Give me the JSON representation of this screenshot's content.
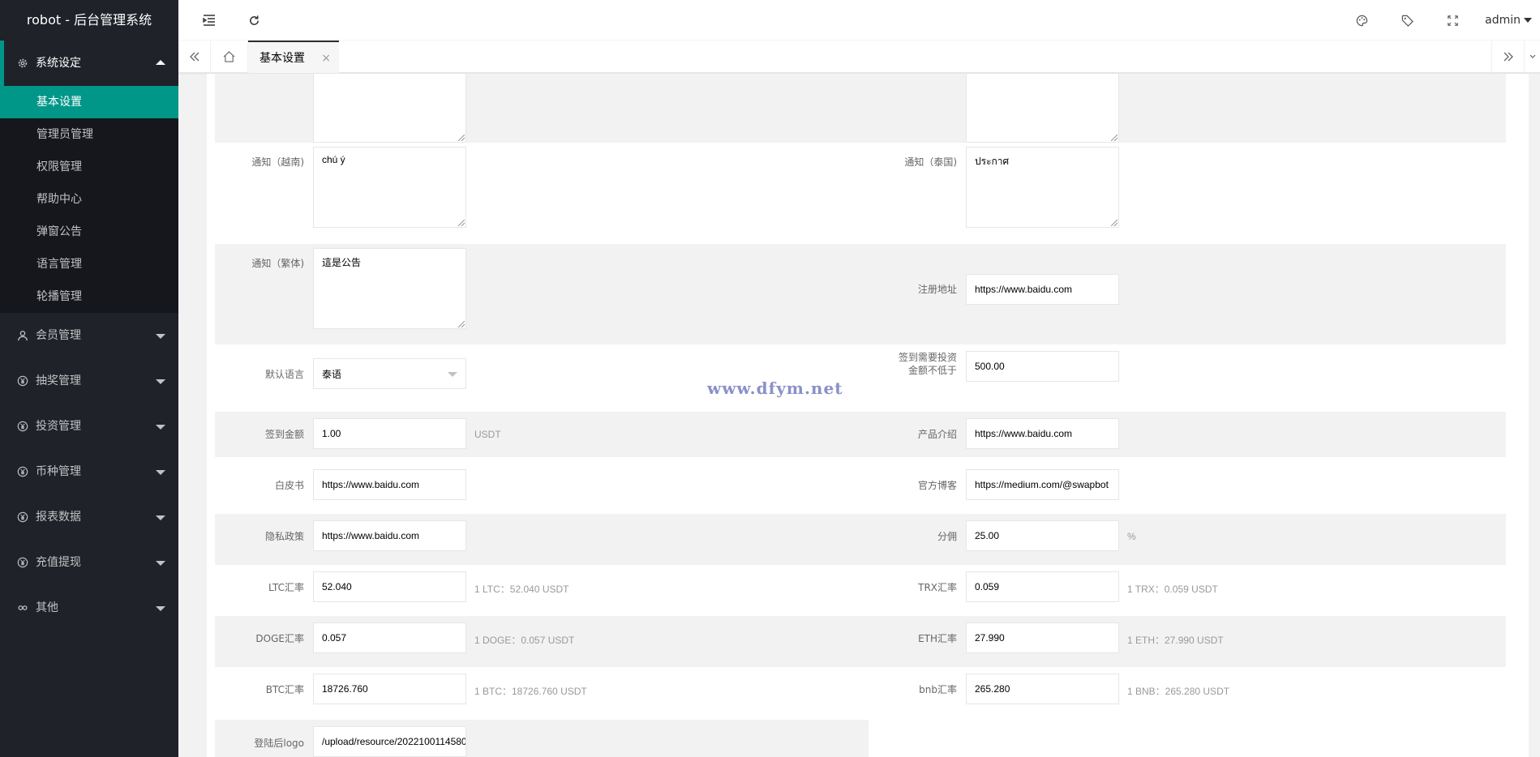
{
  "app_title": "robot - 后台管理系统",
  "header": {
    "user": "admin"
  },
  "sidebar": {
    "groups": [
      {
        "label": "系统设定",
        "icon": "gear-icon",
        "open": true,
        "items": [
          "基本设置",
          "管理员管理",
          "权限管理",
          "帮助中心",
          "弹窗公告",
          "语言管理",
          "轮播管理"
        ],
        "active_item": "基本设置"
      },
      {
        "label": "会员管理",
        "icon": "user-icon",
        "open": false
      },
      {
        "label": "抽奖管理",
        "icon": "yen-icon",
        "open": false
      },
      {
        "label": "投资管理",
        "icon": "yen-icon",
        "open": false
      },
      {
        "label": "币种管理",
        "icon": "yen-icon",
        "open": false
      },
      {
        "label": "报表数据",
        "icon": "yen-icon",
        "open": false
      },
      {
        "label": "充值提现",
        "icon": "yen-icon",
        "open": false
      },
      {
        "label": "其他",
        "icon": "link-icon",
        "open": false
      }
    ]
  },
  "tabs": {
    "active": "基本设置",
    "close": "×"
  },
  "form": {
    "notice_vi": {
      "label": "通知（越南)",
      "value": "chú ý"
    },
    "notice_th": {
      "label": "通知（泰国)",
      "value": "ประกาศ"
    },
    "notice_tw": {
      "label": "通知（繁体)",
      "value": "這是公告"
    },
    "register_url": {
      "label": "注册地址",
      "value": "https://www.baidu.com"
    },
    "default_lang": {
      "label": "默认语言",
      "value": "泰语"
    },
    "checkin_min": {
      "label_line1": "签到需要投资",
      "label_line2": "金额不低于",
      "value": "500.00"
    },
    "checkin_amount": {
      "label": "签到金额",
      "value": "1.00",
      "unit": "USDT"
    },
    "product_intro": {
      "label": "产品介绍",
      "value": "https://www.baidu.com"
    },
    "whitepaper": {
      "label": "白皮书",
      "value": "https://www.baidu.com"
    },
    "blog": {
      "label": "官方博客",
      "value": "https://medium.com/@swapbot"
    },
    "privacy": {
      "label": "隐私政策",
      "value": "https://www.baidu.com"
    },
    "commission": {
      "label": "分佣",
      "value": "25.00",
      "unit": "%"
    },
    "ltc": {
      "label": "LTC汇率",
      "value": "52.040",
      "hint": "1 LTC：52.040 USDT"
    },
    "trx": {
      "label": "TRX汇率",
      "value": "0.059",
      "hint": "1 TRX：0.059 USDT"
    },
    "doge": {
      "label": "DOGE汇率",
      "value": "0.057",
      "hint": "1 DOGE：0.057 USDT"
    },
    "eth": {
      "label": "ETH汇率",
      "value": "27.990",
      "hint": "1 ETH：27.990 USDT"
    },
    "btc": {
      "label": "BTC汇率",
      "value": "18726.760",
      "hint": "1 BTC：18726.760 USDT"
    },
    "bnb": {
      "label": "bnb汇率",
      "value": "265.280",
      "hint": "1 BNB：265.280 USDT"
    },
    "logo": {
      "label": "登陆后logo",
      "value": "/upload/resource/2022100114580"
    }
  },
  "watermark": "www.dfym.net"
}
